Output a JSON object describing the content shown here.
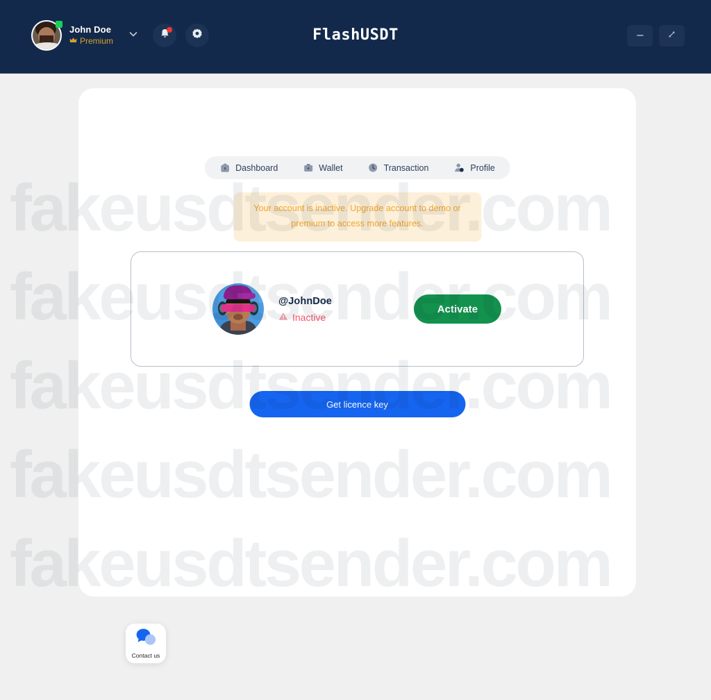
{
  "titlebar": {
    "app_title": "FlashUSDT",
    "user": {
      "name": "John Doe",
      "plan": "Premium",
      "plan_icon": "crown-icon",
      "presence": "online"
    },
    "chevron_icon": "chevron-down-icon",
    "notifications_icon": "bell-icon",
    "notifications_badge": true,
    "settings_icon": "gear-icon",
    "window_controls": {
      "minimize_label": "–",
      "minimize_icon": "minimize-icon",
      "maximize_icon": "maximize-icon"
    },
    "bg_color": "#13294b"
  },
  "tabs": [
    {
      "label": "Dashboard",
      "icon": "home-icon",
      "active": true
    },
    {
      "label": "Wallet",
      "icon": "wallet-icon",
      "active": false
    },
    {
      "label": "Transaction",
      "icon": "clock-icon",
      "active": false
    },
    {
      "label": "Profile",
      "icon": "user-icon",
      "active": false
    }
  ],
  "alert": {
    "text": "Your account is inactive. Upgrade account to demo or premium to access more features.",
    "color": "#f0a72e",
    "bg_color": "#fdf0da"
  },
  "profile_card": {
    "avatar_icon": "user-avatar-illustration",
    "handle": "@JohnDoe",
    "status_label": "Inactive",
    "status_icon": "warning-triangle-icon",
    "status_color": "#f4566a",
    "activate_label": "Activate",
    "activate_color": "#13924e"
  },
  "licence": {
    "label": "Get licence key",
    "color": "#1565f0"
  },
  "contact": {
    "label": "Contact us",
    "icon": "chat-bubbles-icon"
  },
  "watermark": {
    "text": "fakeusdtsender.com",
    "rows": 5
  }
}
